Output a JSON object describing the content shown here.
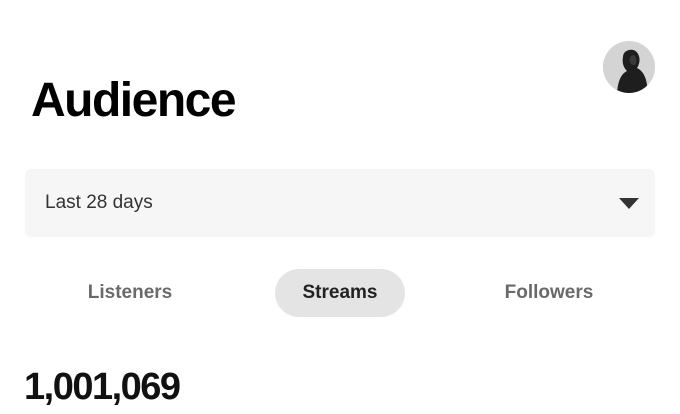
{
  "header": {
    "title": "Audience"
  },
  "user": {
    "avatar_icon": "profile-photo"
  },
  "filter": {
    "period_label": "Last 28 days",
    "caret_icon": "caret-down-icon"
  },
  "tabs": [
    {
      "label": "Listeners",
      "active": false
    },
    {
      "label": "Streams",
      "active": true
    },
    {
      "label": "Followers",
      "active": false
    }
  ],
  "metric": {
    "value": "1,001,069"
  },
  "colors": {
    "background": "#ffffff",
    "select_bg": "#f6f6f6",
    "active_tab_bg": "#e4e4e4",
    "inactive_tab_text": "#6a6a6a"
  }
}
